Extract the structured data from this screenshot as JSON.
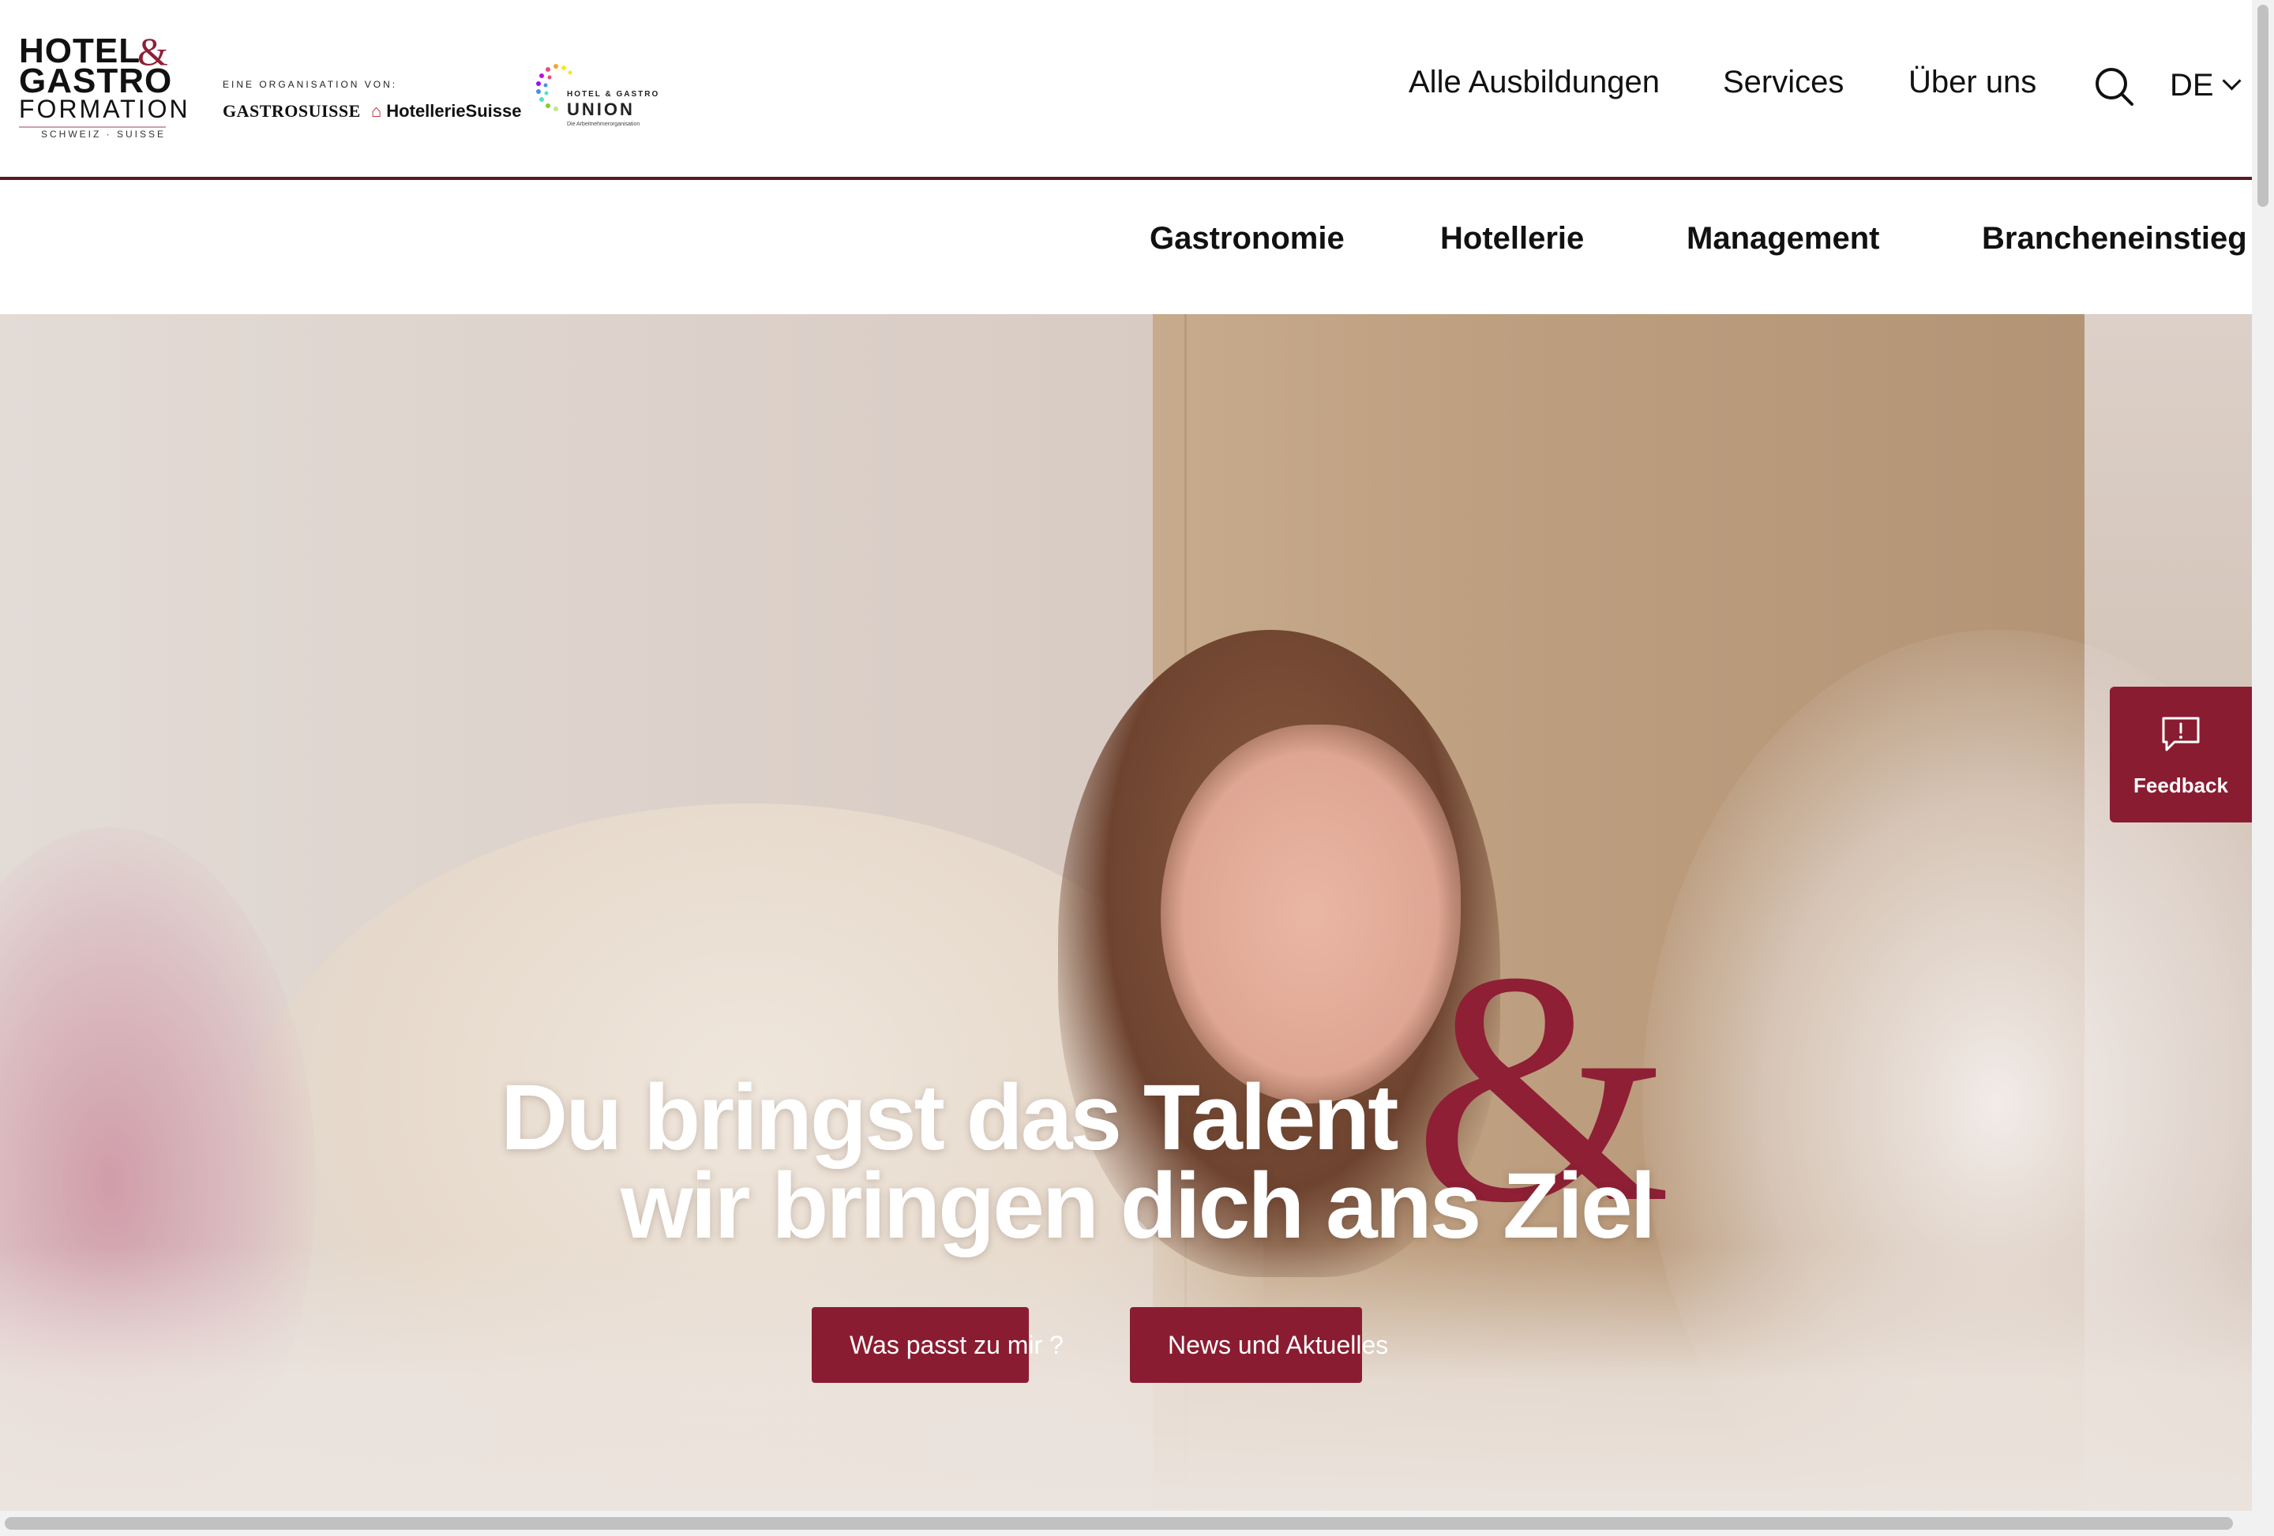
{
  "brand": {
    "logo_line1": "HOTEL",
    "logo_amp": "&",
    "logo_line2": "GASTRO",
    "logo_line3": "FORMATION",
    "logo_line4": "SCHWEIZ · SUISSE",
    "accent_color": "#8e1f35"
  },
  "partners": {
    "label": "EINE ORGANISATION VON:",
    "gastrosuisse": "GASTROSUISSE",
    "hotelleriesuisse": "HotellerieSuisse",
    "union_small": "HOTEL & GASTRO",
    "union_big": "UNION",
    "union_tagline": "Die Arbeitnehmerorganisation"
  },
  "topnav": {
    "items": [
      "Alle Ausbildungen",
      "Services",
      "Über uns"
    ],
    "search_icon": "search-icon",
    "language": "DE"
  },
  "subnav": {
    "items": [
      "Gastronomie",
      "Hotellerie",
      "Management",
      "Brancheneinstieg"
    ]
  },
  "hero": {
    "headline_line1": "Du bringst das Talent",
    "headline_amp": "&",
    "headline_line2": "wir bringen dich ans Ziel",
    "cta_primary": "Was passt zu mir ?",
    "cta_secondary": "News und Aktuelles",
    "button_color": "#8a1c32"
  },
  "feedback": {
    "label": "Feedback",
    "icon": "feedback-icon"
  }
}
